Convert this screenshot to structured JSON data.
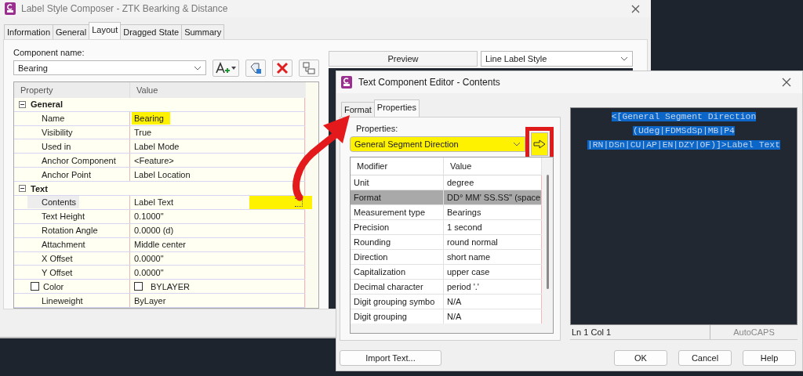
{
  "main_window": {
    "title": "Label Style Composer - ZTK Bearking & Distance",
    "tabs": [
      {
        "label": "Information",
        "selected": false
      },
      {
        "label": "General",
        "selected": false
      },
      {
        "label": "Layout",
        "selected": true
      },
      {
        "label": "Dragged State",
        "selected": false
      },
      {
        "label": "Summary",
        "selected": false
      }
    ],
    "component_name_label": "Component name:",
    "component_name": "Bearing",
    "property_grid": {
      "columns": [
        "Property",
        "Value"
      ],
      "groups": [
        {
          "name": "General",
          "expanded": true,
          "rows": [
            {
              "property": "Name",
              "value": "Bearing",
              "value_highlighted": true,
              "selected": false
            },
            {
              "property": "Visibility",
              "value": "True",
              "selected": false
            },
            {
              "property": "Used in",
              "value": "Label Mode",
              "selected": false
            },
            {
              "property": "Anchor Component",
              "value": "<Feature>",
              "selected": false
            },
            {
              "property": "Anchor Point",
              "value": "Label Location",
              "selected": false
            }
          ]
        },
        {
          "name": "Text",
          "expanded": true,
          "rows": [
            {
              "property": "Contents",
              "value": "Label Text",
              "button_highlighted": true,
              "selected": true
            },
            {
              "property": "Text Height",
              "value": "0.1000\"",
              "selected": false
            },
            {
              "property": "Rotation Angle",
              "value": "0.0000 (d)",
              "selected": false
            },
            {
              "property": "Attachment",
              "value": "Middle center",
              "selected": false
            },
            {
              "property": "X Offset",
              "value": "0.0000\"",
              "selected": false
            },
            {
              "property": "Y Offset",
              "value": "0.0000\"",
              "selected": false
            },
            {
              "property": "Color",
              "value": "BYLAYER",
              "kind": "checkbox",
              "checked": false,
              "selected": false
            },
            {
              "property": "Lineweight",
              "value": "ByLayer",
              "selected": false
            }
          ]
        }
      ]
    },
    "preview": {
      "label": "Preview",
      "style": "Line Label Style"
    }
  },
  "dialog": {
    "title": "Text Component Editor - Contents",
    "tabs": [
      {
        "label": "Format",
        "selected": false
      },
      {
        "label": "Properties",
        "selected": true
      }
    ],
    "properties_label": "Properties:",
    "property": "General Segment Direction",
    "property_highlighted": true,
    "insert_highlighted": true,
    "modifiers": {
      "columns": [
        "Modifier",
        "Value"
      ],
      "rows": [
        {
          "modifier": "Unit",
          "value": "degree",
          "selected": false
        },
        {
          "modifier": "Format",
          "value": "DD° MM' SS.SS\" (space",
          "selected": true
        },
        {
          "modifier": "Measurement type",
          "value": "Bearings",
          "selected": false
        },
        {
          "modifier": "Precision",
          "value": "1 second",
          "selected": false
        },
        {
          "modifier": "Rounding",
          "value": "round normal",
          "selected": false
        },
        {
          "modifier": "Direction",
          "value": "short name",
          "selected": false
        },
        {
          "modifier": "Capitalization",
          "value": "upper case",
          "selected": false
        },
        {
          "modifier": "Decimal character",
          "value": "period '.'",
          "selected": false
        },
        {
          "modifier": "Digit grouping symbo",
          "value": "N/A",
          "selected": false
        },
        {
          "modifier": "Digit grouping",
          "value": "N/A",
          "selected": false
        }
      ]
    },
    "editor_lines": [
      "<[General Segment Direction",
      "(Udeg|FDMSdSp|MB|P4",
      "|RN|DSn|CU|AP|EN|DZY|OF)]>Label Text"
    ],
    "editor_selected": true,
    "status": {
      "position": "Ln 1 Col 1",
      "mode": "AutoCAPS"
    },
    "import_button": "Import Text...",
    "buttons": [
      "OK",
      "Cancel",
      "Help"
    ]
  }
}
